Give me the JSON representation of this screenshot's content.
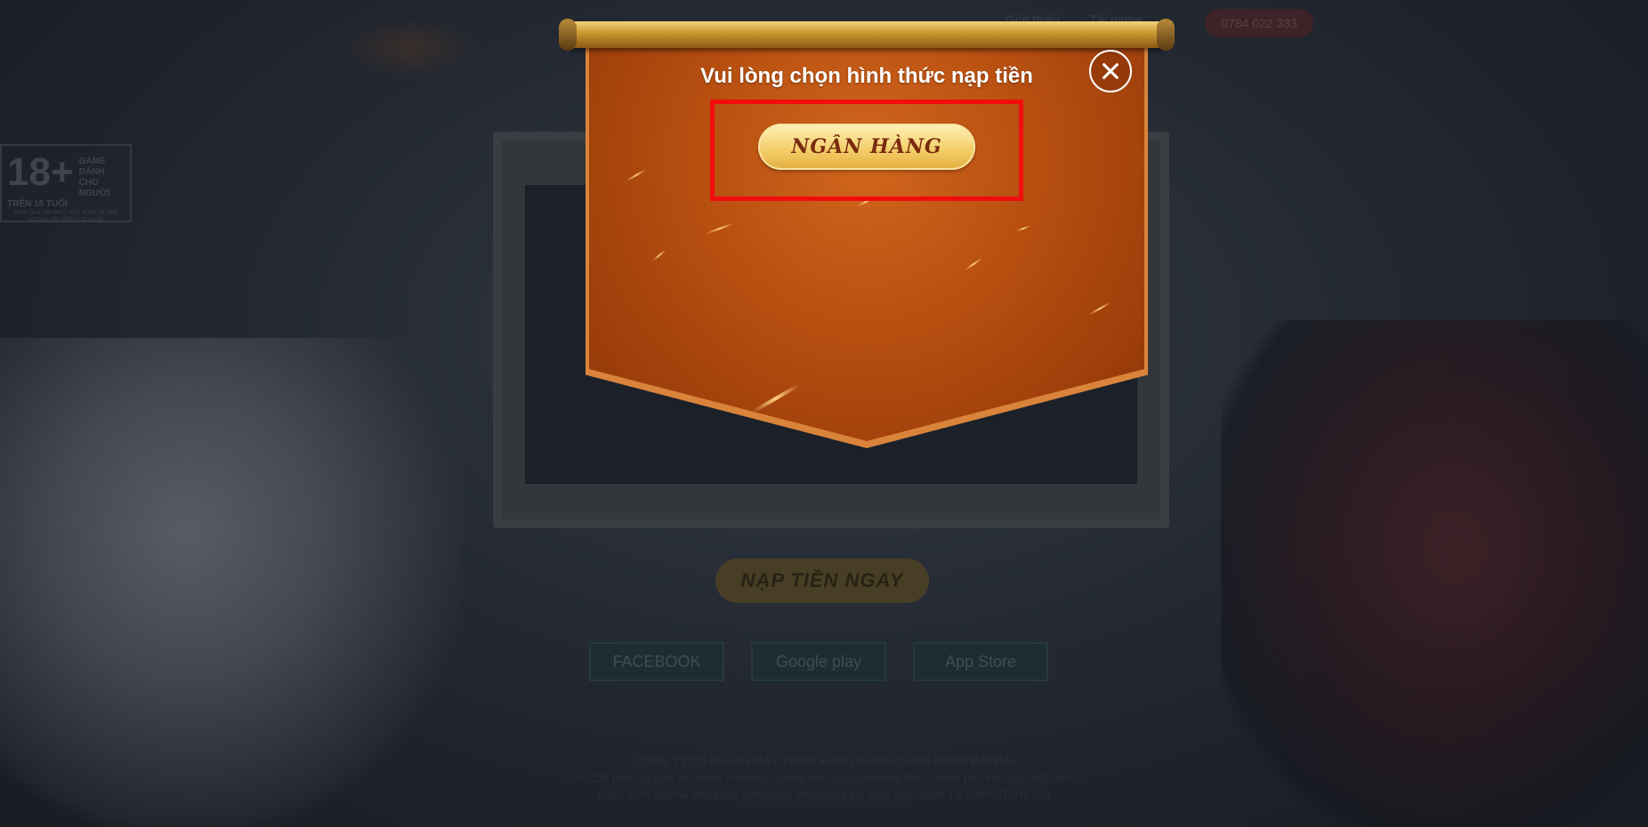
{
  "nav": {
    "links": [
      "Giới thiệu",
      "Tải game"
    ],
    "phone": "0784 022 333"
  },
  "age_badge": {
    "age": "18+",
    "text": "GAME DÀNH CHO NGƯỜI TRÊN 18 TUỔI",
    "note": "CHƠI QUÁ 180 PHÚT MỘT NGÀY SẼ ẢNH HƯỞNG XẤU ĐẾN SỨC KHỎE"
  },
  "main": {
    "cta_label": "NẠP TIỀN NGAY"
  },
  "stores": [
    {
      "label": "FACEBOOK",
      "icon": "facebook-icon"
    },
    {
      "label": "Google play",
      "icon": "google-play-icon"
    },
    {
      "label": "App Store",
      "icon": "app-store-icon"
    }
  ],
  "footer": {
    "company": "CÔNG TY CỔ PHẦN PHÁT TRIỂN KINH DOANH CÔNG NGHỆ ĐẠI HẢI",
    "address1": "Số 158 phố Nguyễn An Ninh, Phường Tương Mai, Quận Hoàng Mai, Thành phố Hà Nội, Việt Nam",
    "address2": "Giao dịch: sảnh A office tòa Vinhomes Westpoint Đỗ Đức Dục, Nam Từ Liêm, TP Hà Nội"
  },
  "modal": {
    "title": "Vui lòng chọn hình thức nạp tiền",
    "option_label": "NGÂN HÀNG",
    "close_icon": "close-icon",
    "highlight_color": "#f20d0d"
  }
}
